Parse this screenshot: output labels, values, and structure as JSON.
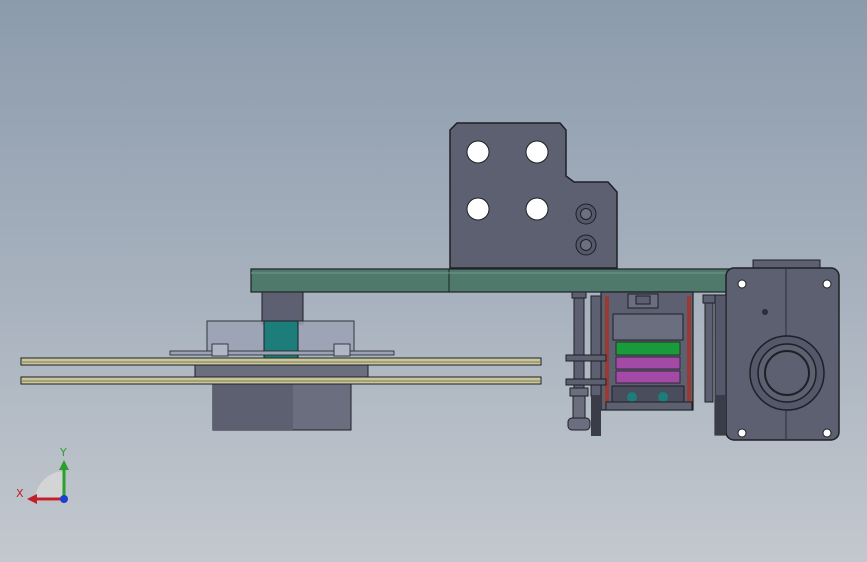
{
  "triad": {
    "x_label": "X",
    "y_label": "Y",
    "x_color": "#c0202a",
    "y_color": "#2ca02c",
    "z_color": "#1f3fd0"
  },
  "colors": {
    "background_top": "#8c9bac",
    "background_bottom": "#c3c8ce",
    "metal_dark": "#5c6070",
    "metal_mid": "#6e7282",
    "plate_green": "#4f7a6b",
    "teal": "#1d7d7a",
    "rod_gold": "#c9c79a",
    "green_band": "#1a9a3a",
    "magenta_band": "#a24aa6"
  }
}
